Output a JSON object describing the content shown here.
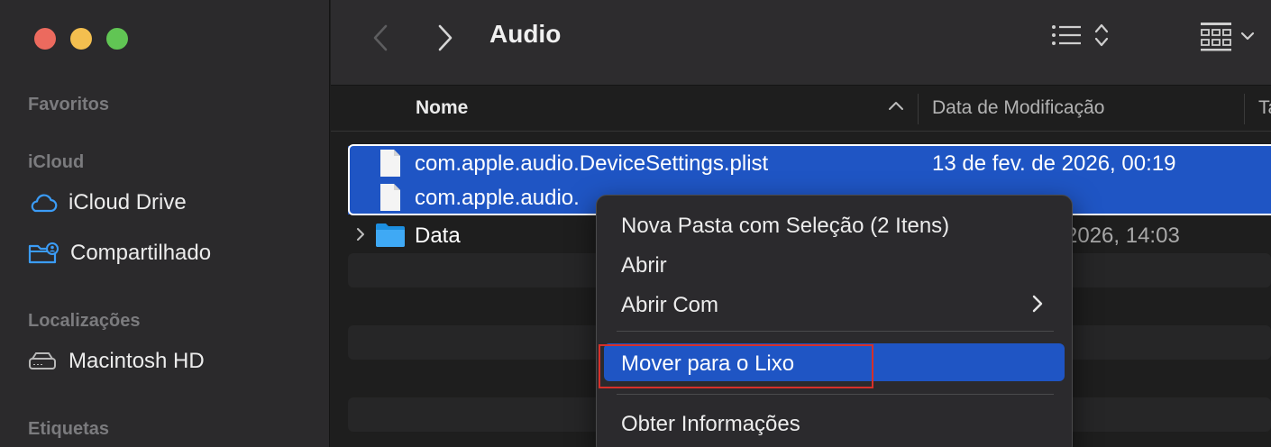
{
  "window": {
    "title": "Audio"
  },
  "sidebar": {
    "sections": {
      "favorites": "Favoritos",
      "icloud": "iCloud",
      "locations": "Localizações",
      "tags": "Etiquetas"
    },
    "items": [
      {
        "label": "iCloud Drive",
        "icon": "cloud-icon"
      },
      {
        "label": "Compartilhado",
        "icon": "shared-folder-icon"
      },
      {
        "label": "Macintosh HD",
        "icon": "hard-drive-icon"
      }
    ]
  },
  "columns": {
    "name": "Nome",
    "date": "Data de Modificação",
    "size": "Ta"
  },
  "files": [
    {
      "name": "com.apple.audio.DeviceSettings.plist",
      "date": "13 de fev. de 2026, 00:19",
      "selected": true
    },
    {
      "name": "com.apple.audio.",
      "date": "",
      "selected": true
    },
    {
      "name": "Data",
      "date": "2026, 14:03",
      "selected": false
    }
  ],
  "context_menu": {
    "items": [
      {
        "label": "Nova Pasta com Seleção (2 Itens)"
      },
      {
        "label": "Abrir"
      },
      {
        "label": "Abrir Com"
      },
      {
        "label": "Mover para o Lixo"
      },
      {
        "label": "Obter Informações"
      }
    ]
  },
  "colors": {
    "selection": "#1f55c4",
    "highlight_box": "#d6302a",
    "sidebar_icon": "#3b9cf7"
  }
}
